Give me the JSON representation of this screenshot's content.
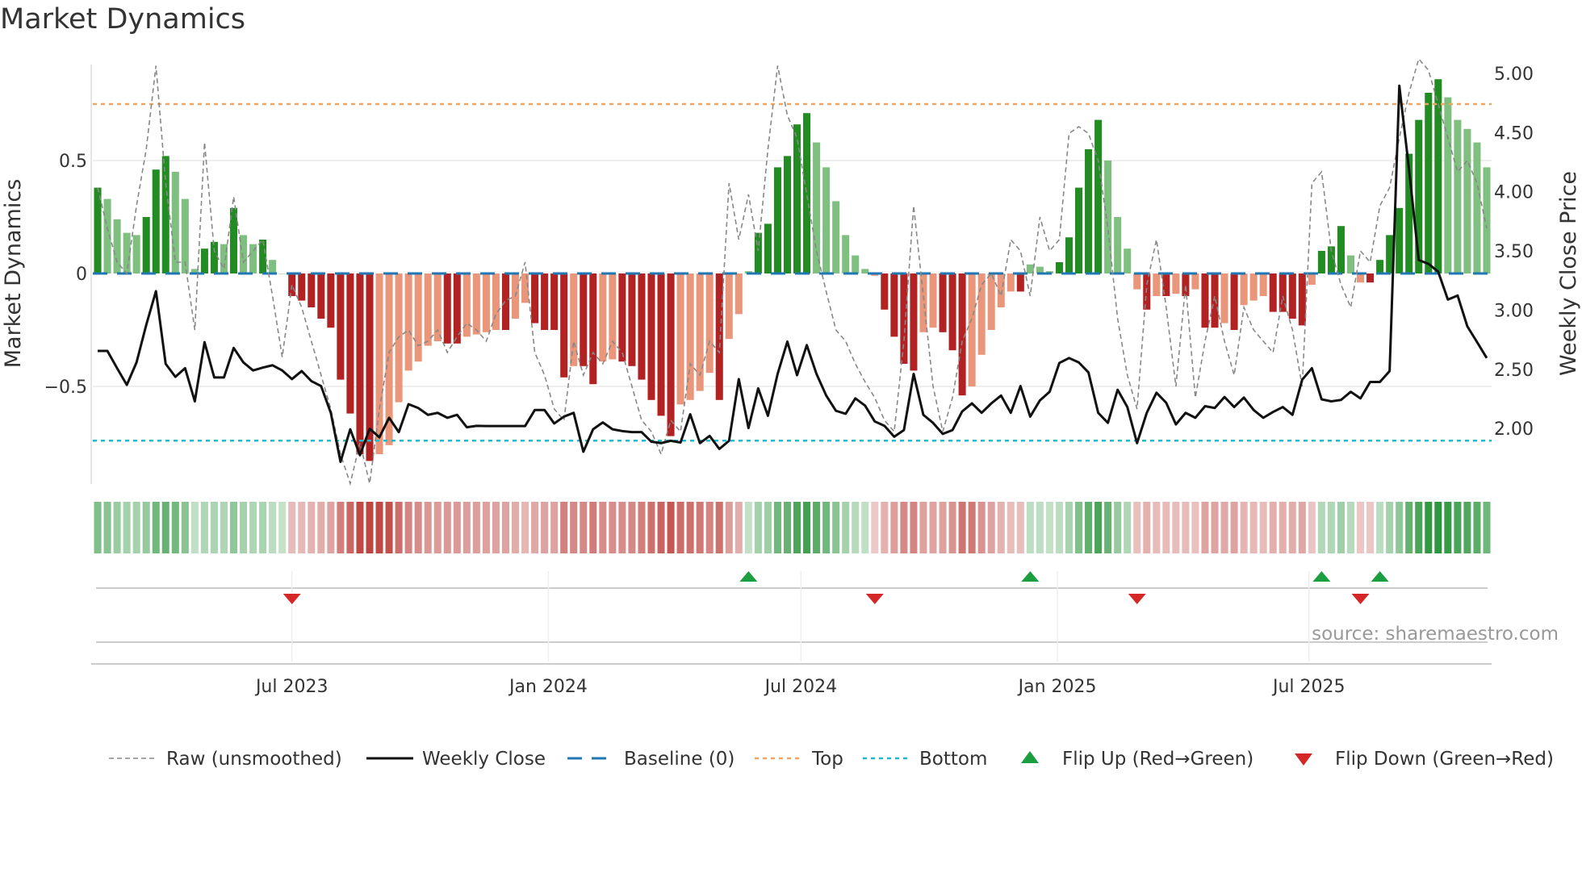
{
  "chart_data": {
    "type": "bar",
    "title": "Market Dynamics",
    "ylabel": "Market Dynamics",
    "y2label": "Weekly Close Price",
    "ylim": [
      -0.92,
      0.93
    ],
    "y2lim": [
      1.62,
      5.15
    ],
    "yticks": [
      {
        "value": 0.5,
        "label": "0.5"
      },
      {
        "value": 0,
        "label": "0"
      },
      {
        "value": -0.5,
        "label": "−0.5"
      }
    ],
    "y2ticks": [
      {
        "value": 5.0,
        "label": "5.00"
      },
      {
        "value": 4.5,
        "label": "4.50"
      },
      {
        "value": 4.0,
        "label": "4.00"
      },
      {
        "value": 3.5,
        "label": "3.50"
      },
      {
        "value": 3.0,
        "label": "3.00"
      },
      {
        "value": 2.5,
        "label": "2.50"
      },
      {
        "value": 2.0,
        "label": "2.00"
      }
    ],
    "xticks": [
      {
        "week": 20,
        "label": "Jul 2023"
      },
      {
        "week": 46.4,
        "label": "Jan 2024"
      },
      {
        "week": 72.4,
        "label": "Jul 2024"
      },
      {
        "week": 98.8,
        "label": "Jan 2025"
      },
      {
        "week": 124.7,
        "label": "Jul 2025"
      }
    ],
    "top": 0.75,
    "bottom": -0.74,
    "baseline": 0,
    "dynamics": [
      0.38,
      0.33,
      0.24,
      0.18,
      0.17,
      0.25,
      0.46,
      0.52,
      0.45,
      0.33,
      0.02,
      0.11,
      0.14,
      0.13,
      0.29,
      0.17,
      0.13,
      0.15,
      0.06,
      0.0,
      -0.1,
      -0.12,
      -0.15,
      -0.2,
      -0.24,
      -0.47,
      -0.62,
      -0.8,
      -0.83,
      -0.8,
      -0.76,
      -0.57,
      -0.43,
      -0.39,
      -0.32,
      -0.3,
      -0.31,
      -0.31,
      -0.28,
      -0.27,
      -0.26,
      -0.25,
      -0.25,
      -0.2,
      -0.13,
      -0.22,
      -0.25,
      -0.25,
      -0.46,
      -0.41,
      -0.41,
      -0.49,
      -0.39,
      -0.38,
      -0.39,
      -0.41,
      -0.47,
      -0.56,
      -0.63,
      -0.72,
      -0.58,
      -0.56,
      -0.52,
      -0.44,
      -0.56,
      -0.29,
      -0.18,
      0.01,
      0.18,
      0.22,
      0.47,
      0.52,
      0.66,
      0.71,
      0.58,
      0.47,
      0.32,
      0.17,
      0.08,
      0.02,
      -0.01,
      -0.16,
      -0.28,
      -0.4,
      -0.43,
      -0.26,
      -0.24,
      -0.26,
      -0.34,
      -0.54,
      -0.5,
      -0.36,
      -0.25,
      -0.15,
      -0.08,
      -0.08,
      0.04,
      0.03,
      0.01,
      0.05,
      0.16,
      0.38,
      0.55,
      0.68,
      0.5,
      0.25,
      0.11,
      -0.07,
      -0.16,
      -0.1,
      -0.1,
      -0.09,
      -0.1,
      -0.07,
      -0.24,
      -0.24,
      -0.22,
      -0.25,
      -0.14,
      -0.12,
      -0.1,
      -0.17,
      -0.17,
      -0.2,
      -0.23,
      -0.05,
      0.1,
      0.12,
      0.21,
      0.08,
      -0.04,
      -0.04,
      0.06,
      0.17,
      0.29,
      0.53,
      0.68,
      0.8,
      0.86,
      0.78,
      0.68,
      0.64,
      0.58,
      0.47
    ],
    "raw": [
      0.38,
      0.2,
      0.05,
      0.0,
      0.3,
      0.55,
      0.92,
      0.4,
      0.05,
      0.05,
      -0.25,
      0.58,
      0.1,
      0.02,
      0.34,
      0.05,
      0.1,
      0.15,
      -0.1,
      -0.37,
      -0.05,
      -0.15,
      -0.3,
      -0.45,
      -0.6,
      -0.8,
      -0.93,
      -0.75,
      -0.93,
      -0.6,
      -0.35,
      -0.28,
      -0.25,
      -0.32,
      -0.3,
      -0.25,
      -0.35,
      -0.28,
      -0.22,
      -0.25,
      -0.3,
      -0.18,
      -0.12,
      -0.1,
      0.05,
      -0.35,
      -0.45,
      -0.6,
      -0.65,
      -0.3,
      -0.45,
      -0.35,
      -0.4,
      -0.3,
      -0.35,
      -0.5,
      -0.65,
      -0.7,
      -0.8,
      -0.65,
      -0.7,
      -0.4,
      -0.45,
      -0.3,
      -0.35,
      0.4,
      0.15,
      0.35,
      0.1,
      0.55,
      0.92,
      0.7,
      0.6,
      0.35,
      0.1,
      -0.08,
      -0.25,
      -0.3,
      -0.4,
      -0.48,
      -0.55,
      -0.65,
      -0.7,
      -0.3,
      0.3,
      -0.1,
      -0.5,
      -0.7,
      -0.55,
      -0.3,
      -0.2,
      -0.05,
      0.0,
      -0.1,
      0.15,
      0.1,
      -0.1,
      0.25,
      0.1,
      0.15,
      0.62,
      0.65,
      0.62,
      0.5,
      0.2,
      -0.2,
      -0.45,
      -0.6,
      -0.05,
      0.15,
      -0.15,
      -0.5,
      -0.05,
      -0.55,
      -0.3,
      -0.1,
      -0.3,
      -0.45,
      -0.15,
      -0.25,
      -0.3,
      -0.35,
      -0.1,
      -0.25,
      -0.5,
      0.4,
      0.45,
      0.1,
      -0.05,
      -0.15,
      0.1,
      0.05,
      0.3,
      0.38,
      0.6,
      0.8,
      0.95,
      0.9,
      0.75,
      0.6,
      0.45,
      0.5,
      0.4,
      0.2
    ],
    "weekly_close": [
      2.655,
      2.655,
      2.509,
      2.368,
      2.558,
      2.875,
      3.16,
      2.546,
      2.436,
      2.509,
      2.229,
      2.729,
      2.431,
      2.431,
      2.68,
      2.558,
      2.49,
      2.514,
      2.534,
      2.49,
      2.417,
      2.485,
      2.4,
      2.358,
      2.132,
      1.718,
      1.993,
      1.774,
      1.998,
      1.925,
      2.09,
      1.969,
      2.205,
      2.173,
      2.115,
      2.132,
      2.09,
      2.115,
      2.01,
      2.022,
      2.02,
      2.02,
      2.02,
      2.02,
      2.02,
      2.156,
      2.156,
      2.042,
      2.1,
      2.132,
      1.803,
      1.993,
      2.051,
      1.993,
      1.978,
      1.969,
      1.969,
      1.888,
      1.876,
      1.896,
      1.881,
      2.12,
      1.876,
      1.937,
      1.827,
      1.896,
      2.417,
      2.003,
      2.339,
      2.107,
      2.461,
      2.734,
      2.45,
      2.704,
      2.461,
      2.278,
      2.149,
      2.124,
      2.254,
      2.193,
      2.059,
      2.022,
      1.93,
      1.986,
      2.461,
      2.115,
      2.047,
      1.954,
      1.986,
      2.144,
      2.212,
      2.132,
      2.212,
      2.278,
      2.132,
      2.358,
      2.1,
      2.237,
      2.31,
      2.553,
      2.595,
      2.558,
      2.473,
      2.132,
      2.047,
      2.327,
      2.181,
      1.876,
      2.132,
      2.302,
      2.217,
      2.034,
      2.132,
      2.09,
      2.188,
      2.173,
      2.266,
      2.181,
      2.261,
      2.156,
      2.09,
      2.139,
      2.181,
      2.115,
      2.412,
      2.509,
      2.246,
      2.229,
      2.241,
      2.31,
      2.254,
      2.393,
      2.393,
      2.485,
      4.896,
      4.19,
      3.423,
      3.391,
      3.325,
      3.089,
      3.123,
      2.863,
      2.73,
      2.595
    ],
    "flip_up_weeks": [
      67,
      96,
      126,
      132
    ],
    "flip_down_weeks": [
      20,
      80,
      107,
      130
    ],
    "legend": [
      {
        "label": "Raw (unsmoothed)",
        "kind": "raw"
      },
      {
        "label": "Weekly Close",
        "kind": "close"
      },
      {
        "label": "Baseline (0)",
        "kind": "baseline"
      },
      {
        "label": "Top",
        "kind": "top"
      },
      {
        "label": "Bottom",
        "kind": "bottom"
      },
      {
        "label": "Flip Up (Red→Green)",
        "kind": "up"
      },
      {
        "label": "Flip Down (Green→Red)",
        "kind": "down"
      }
    ],
    "legend_position": "bottom",
    "source": "source: sharemaestro.com",
    "colors": {
      "green_dark": "#228b22",
      "green_light": "#7fbf7f",
      "red_dark": "#b22222",
      "red_light": "#e9967a",
      "raw": "#888888",
      "close": "#111111",
      "baseline": "#1f77b4",
      "top": "#f4a460",
      "bottom": "#17becf",
      "flip_up": "#1a9e3f",
      "flip_down": "#d62728"
    }
  }
}
